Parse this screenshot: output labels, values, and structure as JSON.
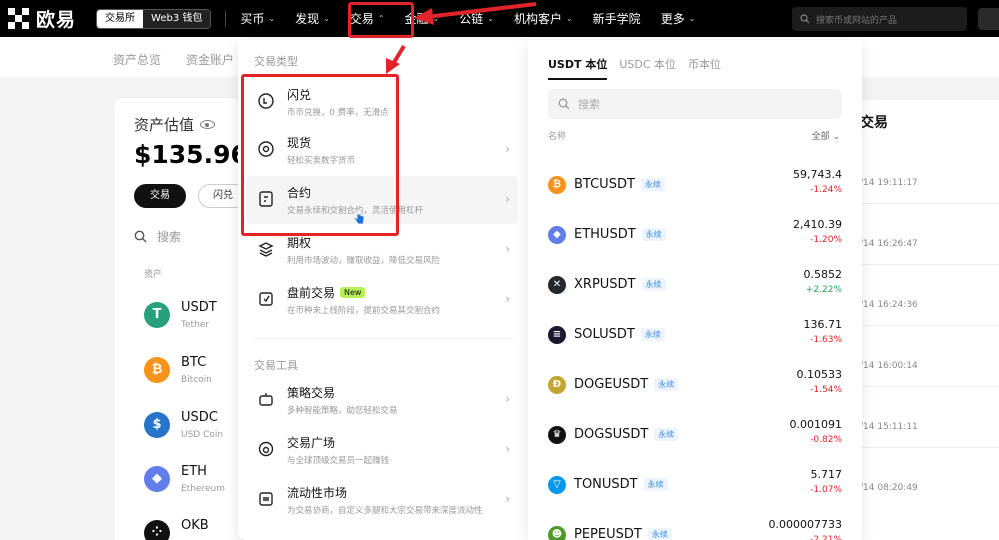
{
  "topnav": {
    "brand": "欧易",
    "mode_exchange": "交易所",
    "mode_web3": "Web3 钱包",
    "items": [
      {
        "label": "买币"
      },
      {
        "label": "发现"
      },
      {
        "label": "交易"
      },
      {
        "label": "金融"
      },
      {
        "label": "公链"
      },
      {
        "label": "机构客户"
      },
      {
        "label": "新手学院"
      },
      {
        "label": "更多"
      }
    ],
    "search_placeholder": "搜索币或网站的产品"
  },
  "subnav": {
    "items": [
      "资产总览",
      "资金账户"
    ]
  },
  "assets": {
    "title": "资产估值",
    "value": "$135.96",
    "trade_btn": "交易",
    "convert_btn": "闪兑",
    "search_placeholder": "搜索",
    "col_header": "资产",
    "rows": [
      {
        "symbol": "USDT",
        "name": "Tether",
        "icon": "T",
        "color": "#26a17b"
      },
      {
        "symbol": "BTC",
        "name": "Bitcoin",
        "icon": "₿",
        "color": "#f7931a"
      },
      {
        "symbol": "USDC",
        "name": "USD Coin",
        "icon": "$",
        "color": "#2775ca"
      },
      {
        "symbol": "ETH",
        "name": "Ethereum",
        "icon": "◆",
        "color": "#627eea"
      },
      {
        "symbol": "OKB",
        "name": "",
        "icon": "⁘",
        "color": "#111111"
      }
    ]
  },
  "right_panel": {
    "title": "交易",
    "times": [
      "/14 19:11:17",
      "/14 16:26:47",
      "/14 16:24:36",
      "/14 16:00:14",
      "/14 15:11:11",
      "/14 08:20:49"
    ]
  },
  "menu": {
    "section1_title": "交易类型",
    "section2_title": "交易工具",
    "items1": [
      {
        "title": "闪兑",
        "desc": "币币兑换，0 费率，无滑点",
        "icon": "convert-icon",
        "arrow": false,
        "badge": ""
      },
      {
        "title": "现货",
        "desc": "轻松买卖数字货币",
        "icon": "spot-icon",
        "arrow": true,
        "badge": ""
      },
      {
        "title": "合约",
        "desc": "交易永续和交割合约，灵活使用杠杆",
        "icon": "contract-icon",
        "arrow": true,
        "badge": ""
      },
      {
        "title": "期权",
        "desc": "利用市场波动，赚取收益，降低交易风险",
        "icon": "options-icon",
        "arrow": true,
        "badge": ""
      },
      {
        "title": "盘前交易",
        "desc": "在币种未上线阶段，提前交易其交割合约",
        "icon": "premarket-icon",
        "arrow": true,
        "badge": "New"
      }
    ],
    "items2": [
      {
        "title": "策略交易",
        "desc": "多种智能策略，助您轻松交易",
        "icon": "bot-icon",
        "arrow": true
      },
      {
        "title": "交易广场",
        "desc": "与全球顶级交易员一起赚钱",
        "icon": "square-icon",
        "arrow": true
      },
      {
        "title": "流动性市场",
        "desc": "为交易协商，自定义多腿和大宗交易带来深度流动性",
        "icon": "liquidity-icon",
        "arrow": true
      }
    ]
  },
  "market": {
    "tabs": [
      "USDT 本位",
      "USDC 本位",
      "币本位"
    ],
    "search_placeholder": "搜索",
    "col_name": "名称",
    "col_sort": "全部",
    "rows": [
      {
        "symbol": "BTCUSDT",
        "tag": "永续",
        "price": "59,743.4",
        "change": "-1.24%",
        "dir": "neg",
        "icon": "₿",
        "color": "#f7931a"
      },
      {
        "symbol": "ETHUSDT",
        "tag": "永续",
        "price": "2,410.39",
        "change": "-1.20%",
        "dir": "neg",
        "icon": "◆",
        "color": "#627eea"
      },
      {
        "symbol": "XRPUSDT",
        "tag": "永续",
        "price": "0.5852",
        "change": "+2.22%",
        "dir": "pos",
        "icon": "✕",
        "color": "#23292f"
      },
      {
        "symbol": "SOLUSDT",
        "tag": "永续",
        "price": "136.71",
        "change": "-1.63%",
        "dir": "neg",
        "icon": "≡",
        "color": "#1a1a2e"
      },
      {
        "symbol": "DOGEUSDT",
        "tag": "永续",
        "price": "0.10533",
        "change": "-1.54%",
        "dir": "neg",
        "icon": "Ð",
        "color": "#c2a633"
      },
      {
        "symbol": "DOGSUSDT",
        "tag": "永续",
        "price": "0.001091",
        "change": "-0.82%",
        "dir": "neg",
        "icon": "♛",
        "color": "#111111"
      },
      {
        "symbol": "TONUSDT",
        "tag": "永续",
        "price": "5.717",
        "change": "-1.07%",
        "dir": "neg",
        "icon": "▽",
        "color": "#0098ea"
      },
      {
        "symbol": "PEPEUSDT",
        "tag": "永续",
        "price": "0.000007733",
        "change": "-2.21%",
        "dir": "neg",
        "icon": "☻",
        "color": "#4c9a2a"
      }
    ]
  },
  "colors": {
    "annotation": "#e0242a",
    "negative": "#e0242a",
    "positive": "#26a65b"
  }
}
